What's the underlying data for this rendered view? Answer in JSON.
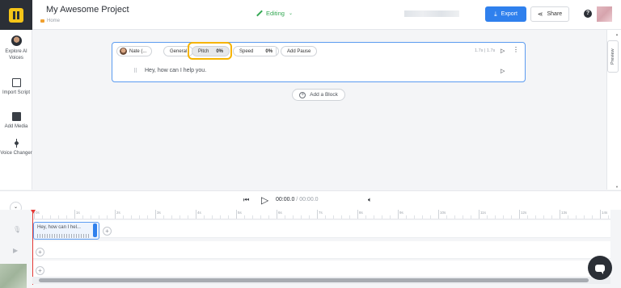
{
  "header": {
    "project_title": "My Awesome Project",
    "breadcrumb": "Home",
    "mode_label": "Editing",
    "export_label": "Export",
    "share_label": "Share",
    "help_icon": "?"
  },
  "sidebar": {
    "items": [
      {
        "label": "Explore AI Voices",
        "icon": "avatar-icon"
      },
      {
        "label": "Import Script",
        "icon": "document-icon"
      },
      {
        "label": "Add Media",
        "icon": "media-icon"
      },
      {
        "label": "Voice Changer",
        "icon": "voice-changer-icon"
      }
    ]
  },
  "block": {
    "voice_name": "Nate (...",
    "general_label": "General",
    "pitch_label": "Pitch",
    "pitch_value": "0%",
    "speed_label": "Speed",
    "speed_value": "0%",
    "add_pause_label": "Add Pause",
    "duration": "1.7s | 1.7s",
    "text": "Hey, how can I help you.",
    "add_block_label": "Add a Block"
  },
  "preview": {
    "label": "Preview"
  },
  "player": {
    "current_time": "00:00.0",
    "separator": " / ",
    "total_time": "00:00.0"
  },
  "timeline": {
    "ticks": [
      "0s",
      "1s",
      "2s",
      "3s",
      "4s",
      "5s",
      "6s",
      "7s",
      "8s",
      "9s",
      "10s",
      "11s",
      "12s",
      "13s",
      "14s"
    ],
    "clip_label": "Hey, how can I hel..."
  },
  "colors": {
    "accent": "#2f80ed",
    "highlight": "#f6b400",
    "editing": "#34a853",
    "playhead": "#e53935"
  }
}
